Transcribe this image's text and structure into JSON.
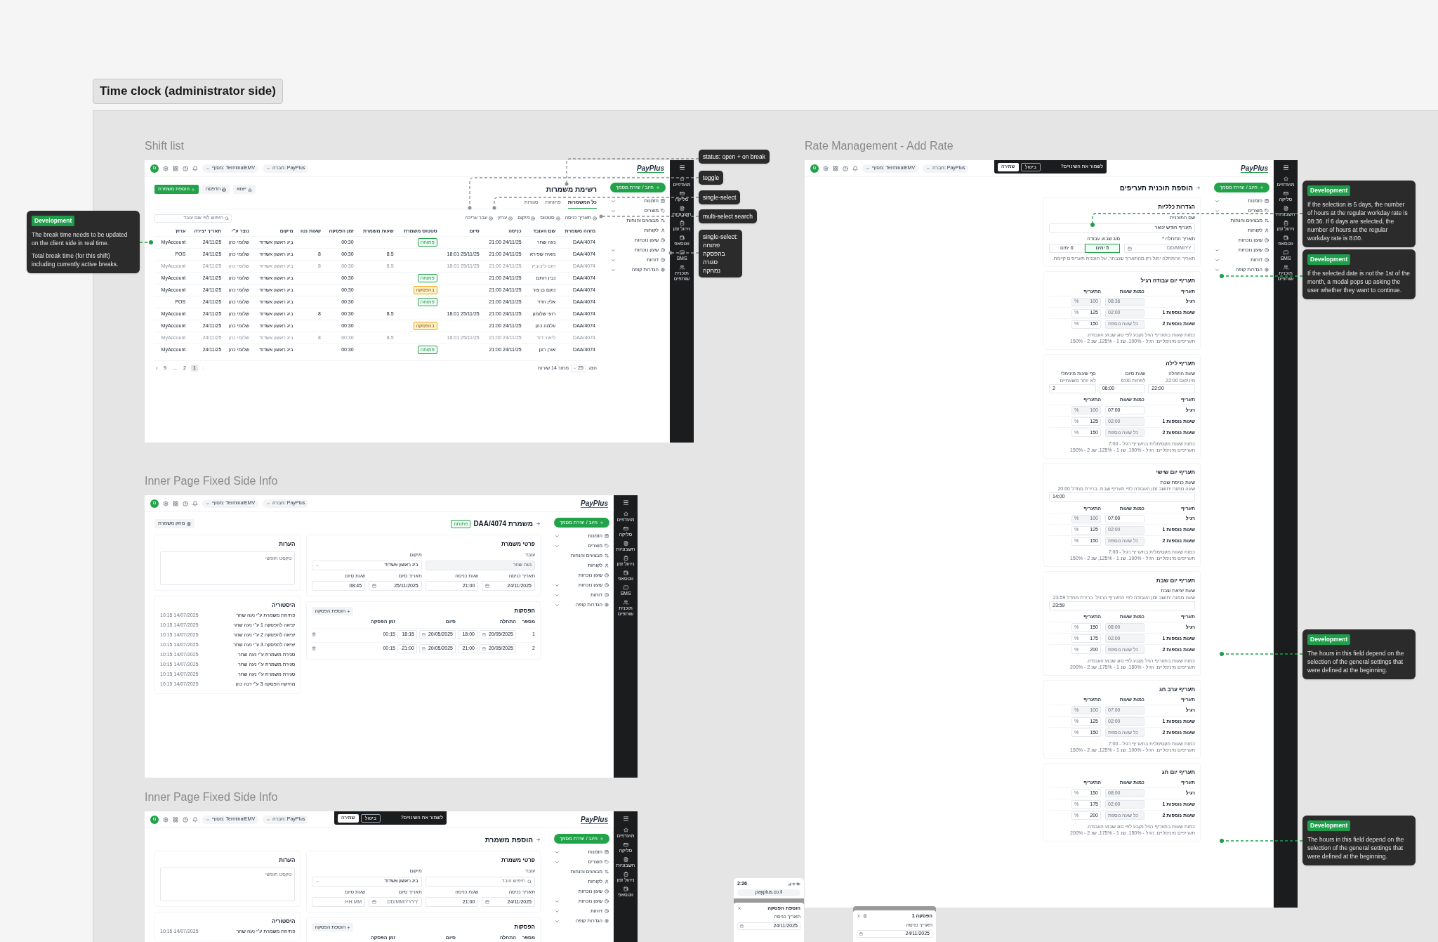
{
  "canvas_title": "Time clock (administrator side)",
  "frames": [
    {
      "kind": "add_rate",
      "label": "Rate Management - Add Rate",
      "chrome": {
        "logo": "PayPlus",
        "avatar": "ס",
        "terminal": "מסוף: TerminalEMV",
        "company": "חברה: PayPlus",
        "action": "חיוב / יצירת מסמך",
        "rail": [
          "מועדפים",
          "סליקה",
          "חשבוניות",
          "ניהול זמן",
          "ווטסאפ",
          "SMS",
          "תוכנית שותפים"
        ],
        "menu": [
          {
            "label": "הזמנות",
            "submenu": true
          },
          {
            "label": "מוצרים",
            "submenu": true
          },
          {
            "label": "מבצעים והנחות",
            "submenu": false
          },
          {
            "label": "לקוחות",
            "submenu": false
          },
          {
            "label": "שעון נוכחות",
            "submenu": false
          },
          {
            "label": "שעון נוכחות",
            "submenu": true
          },
          {
            "label": "דוחות",
            "submenu": true
          },
          {
            "label": "הגדרות קופה",
            "submenu": true
          }
        ],
        "save_bar": {
          "question": "לשמור את השינויים?",
          "cancel": "ביטול",
          "save": "שמירה"
        }
      },
      "title": "הוספת תוכנית תעריפים",
      "general": {
        "title": "הגדרות כלליות",
        "name_label": "שם התוכנית",
        "name_value": "תעריף חודש ינואר",
        "date_label": "תאריך התחלה *",
        "date_placeholder": "DD/MM/YY",
        "week_label": "סוג שבוע עבודה",
        "week_options": [
          {
            "label": "5 ימים",
            "selected": true
          },
          {
            "label": "6 ימים",
            "selected": false
          }
        ],
        "hint": "תאריך ההתחלה יחול רק מהתאריך שנבחר, על תוכנית תעריפים קיימת."
      },
      "rates": [
        {
          "title": "תעריף יום עבודה רגיל",
          "columns": [
            "תעריף",
            "כמות שעות",
            "התעריף"
          ],
          "rows": [
            {
              "name": "רגיל",
              "hours": "08:36",
              "hours_disabled": true,
              "rate": "100",
              "rate_disabled": true,
              "unit": "%"
            },
            {
              "name": "שעות נוספות 1",
              "hours": "02:00",
              "hours_disabled": true,
              "rate": "125",
              "rate_disabled": false,
              "unit": "%"
            },
            {
              "name": "שעות נוספות 2",
              "hours_placeholder": "כל שעה נוספת",
              "hours_disabled": true,
              "rate": "150",
              "rate_disabled": false,
              "unit": "%"
            }
          ],
          "notes": [
            "כמות שעות בתעריף רגיל נקבע לפי סוג שבוע העבודה.",
            "תעריפים מינימליים: רגיל - 100%, שנ 1 - 125%, שנ 2 - 150%"
          ]
        },
        {
          "title": "תעריף לילה",
          "fields": [
            {
              "label": "שעת התחלה",
              "hint": "מינימום 22:00",
              "value": "22:00"
            },
            {
              "label": "שעת סיום",
              "hint": "לפחות 6:00",
              "value": "06:00"
            },
            {
              "label": "סף שעות מינימלי",
              "hint": "לא יותר משעתיים",
              "value": "2"
            }
          ],
          "columns": [
            "תעריף",
            "כמות שעות",
            "התעריף"
          ],
          "rows": [
            {
              "name": "רגיל",
              "hours": "07:00",
              "hours_disabled": false,
              "rate": "100",
              "rate_disabled": true,
              "unit": "%"
            },
            {
              "name": "שעות נוספות 1",
              "hours": "02:00",
              "hours_disabled": true,
              "rate": "125",
              "rate_disabled": false,
              "unit": "%"
            },
            {
              "name": "שעות נוספות 2",
              "hours_placeholder": "כל שעה נוספת",
              "hours_disabled": true,
              "rate": "150",
              "rate_disabled": false,
              "unit": "%"
            }
          ],
          "notes": [
            "כמות שעות מקסימלית בתעריף רגיל - 7:00",
            "תעריפים מינימליים: רגיל - 100%, שנ 1 - 125%, שנ 2 - 150%"
          ]
        },
        {
          "title": "תעריף יום שישי",
          "fields": [
            {
              "label": "שעת כניסת שבת",
              "hint": "שעה ממנה יחושב זמן העבודה לפי תעריף שבת. ברירת מחדל 20:00",
              "value": "14:00"
            }
          ],
          "columns": [
            "תעריף",
            "כמות שעות",
            "התעריף"
          ],
          "rows": [
            {
              "name": "רגיל",
              "hours": "07:00",
              "hours_disabled": false,
              "rate": "100",
              "rate_disabled": true,
              "unit": "%"
            },
            {
              "name": "שעות נוספות 1",
              "hours": "02:00",
              "hours_disabled": true,
              "rate": "125",
              "rate_disabled": false,
              "unit": "%"
            },
            {
              "name": "שעות נוספות 2",
              "hours_placeholder": "כל שעה נוספת",
              "hours_disabled": true,
              "rate": "150",
              "rate_disabled": false,
              "unit": "%"
            }
          ],
          "notes": [
            "כמות שעות מקסימלית בתעריף רגיל - 7:00",
            "תעריפים מינימליים: רגיל - 100%, שנ 1 - 125%, שנ 2 - 150%"
          ]
        },
        {
          "title": "תעריף יום שבת",
          "fields": [
            {
              "label": "שעת יציאת שבת",
              "hint": "שעה ממנה יחושב זמן העבודה לפי התעריף הרגיל. ברירת מחדל 23:59",
              "value": "23:59"
            }
          ],
          "columns": [
            "תעריף",
            "כמות שעות",
            "התעריף"
          ],
          "rows": [
            {
              "name": "רגיל",
              "hours": "08:00",
              "hours_disabled": true,
              "rate": "150",
              "rate_disabled": false,
              "unit": "%"
            },
            {
              "name": "שעות נוספות 1",
              "hours": "02:00",
              "hours_disabled": true,
              "rate": "175",
              "rate_disabled": false,
              "unit": "%"
            },
            {
              "name": "שעות נוספות 2",
              "hours_placeholder": "כל שעה נוספת",
              "hours_disabled": true,
              "rate": "200",
              "rate_disabled": false,
              "unit": "%"
            }
          ],
          "notes": [
            "כמות שעות בתעריף רגיל נקבע לפי סוג שבוע העבודה.",
            "תעריפים מינימליים: רגיל - 150%, שנ 1 - 175%, שנ 2 - 200%"
          ]
        },
        {
          "title": "תעריף ערב חג",
          "columns": [
            "תעריף",
            "כמות שעות",
            "התעריף"
          ],
          "rows": [
            {
              "name": "רגיל",
              "hours": "07:00",
              "hours_disabled": true,
              "rate": "100",
              "rate_disabled": true,
              "unit": "%"
            },
            {
              "name": "שעות נוספות 1",
              "hours": "02:00",
              "hours_disabled": true,
              "rate": "125",
              "rate_disabled": false,
              "unit": "%"
            },
            {
              "name": "שעות נוספות 2",
              "hours_placeholder": "כל שעה נוספת",
              "hours_disabled": true,
              "rate": "150",
              "rate_disabled": false,
              "unit": "%"
            }
          ],
          "notes": [
            "כמות שעות מקסימלית בתעריף רגיל - 7:00",
            "תעריפים מינימליים: רגיל - 100%, שנ 1 - 125%, שנ 2 - 150%"
          ]
        },
        {
          "title": "תעריף יום חג",
          "columns": [
            "תעריף",
            "כמות שעות",
            "התעריף"
          ],
          "rows": [
            {
              "name": "רגיל",
              "hours": "08:00",
              "hours_disabled": true,
              "rate": "150",
              "rate_disabled": false,
              "unit": "%"
            },
            {
              "name": "שעות נוספות 1",
              "hours": "02:00",
              "hours_disabled": true,
              "rate": "175",
              "rate_disabled": false,
              "unit": "%"
            },
            {
              "name": "שעות נוספות 2",
              "hours_placeholder": "כל שעה נוספת",
              "hours_disabled": true,
              "rate": "200",
              "rate_disabled": false,
              "unit": "%"
            }
          ],
          "notes": [
            "כמות שעות בתעריף רגיל נקבע לפי סוג שבוע העבודה.",
            "תעריפים מינימליים: רגיל - 150%, שנ 1 - 175%, שנ 2 - 200%"
          ]
        }
      ]
    },
    {
      "kind": "shift_list",
      "label": "Shift list",
      "chrome": {
        "logo": "PayPlus",
        "avatar": "ס",
        "terminal": "מסוף: TerminalEMV",
        "company": "חברה: PayPlus",
        "action": "חיוב / יצירת מסמך",
        "rail": [
          "מועדפים",
          "סליקה",
          "חשבוניות",
          "ניהול זמן",
          "ווטסאפ",
          "SMS",
          "תוכנית שותפים"
        ],
        "menu": [
          {
            "label": "הזמנות",
            "submenu": true
          },
          {
            "label": "מוצרים",
            "submenu": true
          },
          {
            "label": "מבצעים והנחות",
            "submenu": false
          },
          {
            "label": "לקוחות",
            "submenu": false
          },
          {
            "label": "שעון נוכחות",
            "submenu": false
          },
          {
            "label": "שעון נוכחות",
            "submenu": true
          },
          {
            "label": "דוחות",
            "submenu": true
          },
          {
            "label": "הגדרות קופה",
            "submenu": true
          }
        ]
      },
      "title": "רשימת משמרות",
      "actions": [
        {
          "label": "ייצוא",
          "kind": "export"
        },
        {
          "label": "הדפסה",
          "kind": "print"
        },
        {
          "label": "הוספת משמרת",
          "kind": "primary"
        }
      ],
      "tabs": [
        {
          "label": "כל המשמרות",
          "selected": true
        },
        {
          "label": "פתוחות",
          "selected": false
        },
        {
          "label": "סגורות",
          "selected": false
        }
      ],
      "filters": [
        "תאריך כניסה",
        "סטטוס",
        "מיקום",
        "ערוץ",
        "עבר עריכה"
      ],
      "search": {
        "placeholder": "חיפוש לפי שם עובד"
      },
      "columns": [
        "מזהה משמרת",
        "שם העובד",
        "כניסה",
        "סיום",
        "סטטוס משמרת",
        "שעות משמרת",
        "זמן הפסקה",
        "שעות נטו",
        "מיקום",
        "נוצר ע\"י",
        "תאריך יצירה",
        "ערוץ"
      ],
      "rows": [
        {
          "muted": false,
          "id": "DAA/4074",
          "employee": "נעה שחר",
          "entry": "24/11/25 21:00",
          "status": {
            "label": "פתוחה",
            "kind": "open"
          },
          "break": "00:30",
          "location": "ביג ראשון אשדוד",
          "created_by": "שלומי כהן",
          "created_at": "24/11/25",
          "channel": "MyAccount"
        },
        {
          "muted": false,
          "id": "DAA/4074",
          "employee": "מאיה שפירא",
          "entry": "24/11/25 21:00",
          "end": "25/11/25 18:01",
          "shift_hours": "8.5",
          "break": "00:30",
          "net_hours": "8",
          "location": "ביג ראשון אשדוד",
          "created_by": "שלומי כהן",
          "created_at": "24/11/25",
          "channel": "POS"
        },
        {
          "muted": true,
          "id": "DAA/4074",
          "employee": "תום ליבוביץ",
          "entry": "24/11/25 21:00",
          "end": "25/11/25 18:01",
          "shift_hours": "8.5",
          "break": "00:30",
          "net_hours": "8",
          "location": "ביג ראשון אשדוד",
          "created_by": "שלומי כהן",
          "created_at": "24/11/25",
          "channel": "MyAccount"
        },
        {
          "muted": false,
          "id": "DAA/4074",
          "employee": "נבין רותם",
          "entry": "24/11/25 21:00",
          "status": {
            "label": "פתוחה",
            "kind": "open"
          },
          "break": "00:30",
          "location": "ביג ראשון אשדוד",
          "created_by": "שלומי כהן",
          "created_at": "24/11/25",
          "channel": "MyAccount"
        },
        {
          "muted": false,
          "id": "DAA/4074",
          "employee": "נועם בן צור",
          "entry": "24/11/25 21:00",
          "status": {
            "label": "בהפסקה",
            "kind": "break"
          },
          "break": "00:30",
          "location": "ביג ראשון אשדוד",
          "created_by": "שלומי כהן",
          "created_at": "24/11/25",
          "channel": "MyAccount"
        },
        {
          "muted": false,
          "id": "DAA/4074",
          "employee": "אלין חדד",
          "entry": "24/11/25 21:00",
          "status": {
            "label": "פתוחה",
            "kind": "open"
          },
          "break": "00:30",
          "location": "ביג ראשון אשדוד",
          "created_by": "שלומי כהן",
          "created_at": "24/11/25",
          "channel": "POS"
        },
        {
          "muted": false,
          "id": "DAA/4074",
          "employee": "רועי שלומון",
          "entry": "24/11/25 21:00",
          "end": "25/11/25 18:01",
          "shift_hours": "8.5",
          "break": "00:30",
          "net_hours": "8",
          "location": "ביג ראשון אשדוד",
          "created_by": "שלומי כהן",
          "created_at": "24/11/25",
          "channel": "MyAccount"
        },
        {
          "muted": false,
          "id": "DAA/4074",
          "employee": "עלמה כהן",
          "entry": "24/11/25 21:00",
          "status": {
            "label": "בהפסקה",
            "kind": "break"
          },
          "break": "00:30",
          "location": "ביג ראשון אשדוד",
          "created_by": "שלומי כהן",
          "created_at": "24/11/25",
          "channel": "MyAccount"
        },
        {
          "muted": true,
          "id": "DAA/4074",
          "employee": "ליאור דוד",
          "entry": "24/11/25 21:00",
          "end": "25/11/25 18:01",
          "shift_hours": "8.5",
          "break": "00:30",
          "net_hours": "8",
          "location": "ביג ראשון אשדוד",
          "created_by": "שלומי כהן",
          "created_at": "24/11/25",
          "channel": "MyAccount"
        },
        {
          "muted": false,
          "id": "DAA/4074",
          "employee": "אורן רונן",
          "entry": "24/11/25 21:00",
          "status": {
            "label": "פתוחה",
            "kind": "open"
          },
          "break": "00:30",
          "location": "ביג ראשון אשדוד",
          "created_by": "שלומי כהן",
          "created_at": "24/11/25",
          "channel": "MyAccount"
        }
      ],
      "pagination": {
        "show": "הצג:",
        "page_size": "25",
        "of": "מתוך 14 שורות",
        "pages": [
          {
            "label": "1",
            "selected": true
          },
          {
            "label": "2",
            "selected": false
          },
          {
            "label": "...",
            "selected": false
          },
          {
            "label": "9",
            "selected": false
          }
        ]
      }
    },
    {
      "kind": "shift_detail",
      "label": "Inner Page Fixed Side Info",
      "chrome": {
        "logo": "PayPlus",
        "avatar": "ס",
        "terminal": "מסוף: TerminalEMV",
        "company": "חברה: PayPlus",
        "action": "חיוב / יצירת מסמך",
        "rail": [
          "מועדפים",
          "סליקה",
          "חשבוניות",
          "ניהול זמן",
          "ווטסאפ",
          "SMS",
          "תוכנית שותפים"
        ],
        "menu": [
          {
            "label": "הזמנות",
            "submenu": true
          },
          {
            "label": "מוצרים",
            "submenu": true
          },
          {
            "label": "מבצעים והנחות",
            "submenu": false
          },
          {
            "label": "לקוחות",
            "submenu": false
          },
          {
            "label": "שעון נוכחות",
            "submenu": false
          },
          {
            "label": "שעון נוכחות",
            "submenu": true
          },
          {
            "label": "דוחות",
            "submenu": true
          },
          {
            "label": "הגדרות קופה",
            "submenu": true
          }
        ]
      },
      "title": "משמרת DAA/4074",
      "status": {
        "label": "פתוחה",
        "kind": "open"
      },
      "delete": "מחק משמרת",
      "details": {
        "title": "פרטי משמרת",
        "fields": [
          {
            "label": "עובד",
            "value": "נעה שחר",
            "kind": "text",
            "disabled": true
          },
          {
            "label": "מיקום",
            "value": "ביג ראשון אשדוד",
            "kind": "select",
            "disabled": false
          },
          {
            "label": "תאריך כניסה",
            "value": "24/11/2025",
            "kind": "date",
            "disabled": false
          },
          {
            "label": "שעת כניסה",
            "value": "21:00",
            "kind": "text",
            "disabled": false
          },
          {
            "label": "תאריך סיום",
            "value": "25/11/2025",
            "kind": "date",
            "disabled": false
          },
          {
            "label": "שעת סיום",
            "value": "08:45",
            "kind": "text",
            "disabled": false
          }
        ]
      },
      "notes": {
        "title": "הערות",
        "placeholder": "טקסט חופשי"
      },
      "breaks": {
        "title": "הפסקות",
        "add": "הוספת הפסקה",
        "columns": [
          "מספר",
          "התחלה",
          "סיום",
          "זמן הפסקה"
        ],
        "rows": [
          {
            "number": "1",
            "start_date": "20/05/2025",
            "start_time": "18:00",
            "end_date": "20/05/2025",
            "end_time": "18:15",
            "duration": "00:15"
          },
          {
            "number": "2",
            "start_date": "20/05/2025",
            "start_time": "21:00",
            "end_date": "20/05/2025",
            "end_time": "21:00",
            "duration": "00:15"
          }
        ]
      },
      "history": {
        "title": "היסטוריה",
        "entries": [
          {
            "text": "פתיחת משמרת ע\"י נעה שחר",
            "time": "14/07/2025 10:15"
          },
          {
            "text": "יציאה להפסקה 1 ע\"י נעה שחר",
            "time": "14/07/2025 10:15"
          },
          {
            "text": "יציאה להפסקה 2 ע\"י נעה שחר",
            "time": "14/07/2025 10:15"
          },
          {
            "text": "יציאה להפסקה 3 ע\"י נעה שחר",
            "time": "14/07/2025 10:15"
          },
          {
            "text": "סגירת משמרת ע\"י נעה שחר",
            "time": "14/07/2025 10:15"
          },
          {
            "text": "סגירת משמרת ע\"י נעה שחר",
            "time": "14/07/2025 10:15"
          },
          {
            "text": "סגירת משמרת ע\"י נעה שחר",
            "time": "14/07/2025 10:15"
          },
          {
            "text": "מחיקת הפסקה 3 ע\"י דנה כהן",
            "time": "14/07/2025 10:15"
          }
        ]
      }
    },
    {
      "kind": "add_shift",
      "label": "Inner Page Fixed Side Info",
      "chrome": {
        "logo": "PayPlus",
        "avatar": "ס",
        "terminal": "מסוף: TerminalEMV",
        "company": "חברה: PayPlus",
        "action": "חיוב / יצירת מסמך",
        "rail": [
          "מועדפים",
          "סליקה",
          "חשבוניות",
          "ניהול זמן",
          "ווטסאפ"
        ],
        "menu": [
          {
            "label": "הזמנות",
            "submenu": true
          },
          {
            "label": "מוצרים",
            "submenu": true
          },
          {
            "label": "מבצעים והנחות",
            "submenu": false
          },
          {
            "label": "לקוחות",
            "submenu": false
          },
          {
            "label": "שעון נוכחות",
            "submenu": false
          },
          {
            "label": "שעון נוכחות",
            "submenu": true
          },
          {
            "label": "דוחות",
            "submenu": true
          },
          {
            "label": "הגדרות קופה",
            "submenu": true
          }
        ],
        "save_bar": {
          "question": "לשמור את השינויים?",
          "cancel": "ביטול",
          "save": "שמירה"
        }
      },
      "title": "הוספת משמרת",
      "details": {
        "title": "פרטי משמרת",
        "fields": [
          {
            "label": "עובד",
            "placeholder": "חיפוש עובד",
            "kind": "search",
            "disabled": false
          },
          {
            "label": "מיקום",
            "value": "ביג ראשון אשדוד",
            "kind": "select",
            "disabled": false
          },
          {
            "label": "תאריך כניסה",
            "value": "24/11/2025",
            "kind": "date",
            "disabled": false
          },
          {
            "label": "שעת כניסה",
            "value": "21:00",
            "kind": "text",
            "disabled": false
          },
          {
            "label": "תאריך סיום",
            "placeholder": "DD/MM/YYYY",
            "kind": "date",
            "disabled": false
          },
          {
            "label": "שעת סיום",
            "placeholder": "HH:MM",
            "kind": "text",
            "disabled": false
          }
        ]
      },
      "notes": {
        "title": "הערות",
        "placeholder": "טקסט חופשי"
      },
      "breaks": {
        "title": "הפסקות",
        "add": "הוספת הפסקה",
        "columns": [
          "מספר",
          "התחלה",
          "סיום",
          "זמן הפסקה"
        ]
      },
      "history": {
        "title": "היסטוריה",
        "entries": [
          {
            "text": "פתיחת משמרת ע\"י נעה שחר",
            "time": "14/07/2025 10:15"
          }
        ]
      }
    }
  ],
  "tooltips": [
    {
      "text": "status: open + on break"
    },
    {
      "text": "toggle"
    },
    {
      "text": "single-select"
    },
    {
      "text": "multi-select search"
    },
    {
      "text": "single-select:",
      "options": [
        "פתוחה",
        "בהפסקה",
        "סגורה",
        "נמחקה"
      ]
    }
  ],
  "dev_notes": [
    {
      "tag": "Development",
      "paragraphs": [
        "The break time needs to be updated on the client side in real time.",
        "Total break time (for this shift) including currently active breaks."
      ]
    },
    {
      "tag": "Development",
      "paragraphs": [
        "If the selection is 5 days, the number of hours at the regular workday rate is 08:36. If 6 days are selected, the number of hours at the regular workday rate is 8:00."
      ]
    },
    {
      "tag": "Development",
      "paragraphs": [
        "If the selected date is not the 1st of the month, a modal pops up asking the user whether they want to continue."
      ]
    },
    {
      "tag": "Development",
      "paragraphs": [
        "The hours in this field depend on the selection of the general settings that were defined at the beginning."
      ]
    },
    {
      "tag": "Development",
      "paragraphs": [
        "The hours in this field depend on the selection of the general settings that were defined at the beginning."
      ]
    }
  ],
  "phones": [
    {
      "time": "2:26",
      "url": "payplus.co.il",
      "sheet_title": "הוספת הפסקה",
      "field_label": "תאריך כניסה",
      "field_value": "24/11/2025",
      "delete": false
    },
    {
      "sheet_title": "הפסקה 1",
      "field_label": "תאריך כניסה",
      "field_value": "24/11/2025",
      "delete": true
    }
  ]
}
